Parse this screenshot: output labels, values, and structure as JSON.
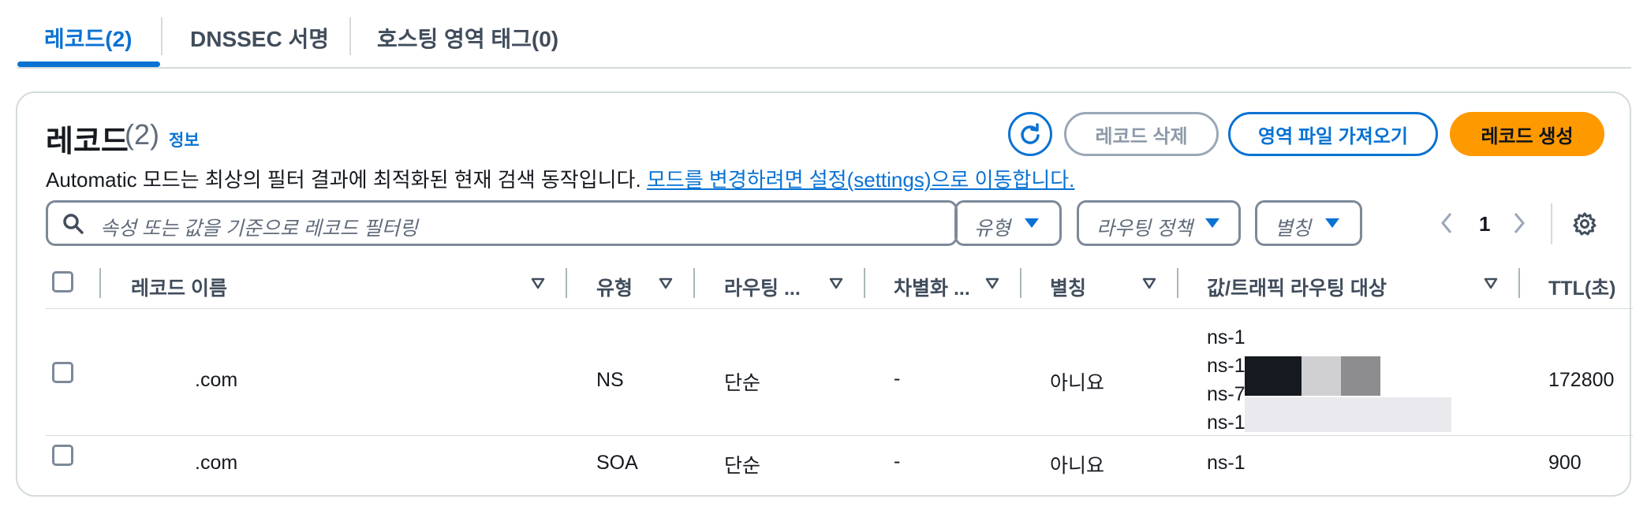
{
  "tabs": [
    {
      "label": "레코드(2)",
      "active": true
    },
    {
      "label": "DNSSEC 서명",
      "active": false
    },
    {
      "label": "호스팅 영역 태그(0)",
      "active": false
    }
  ],
  "panel": {
    "title": "레코드",
    "count": "(2)",
    "info_link": "정보",
    "description": "Automatic 모드는 최상의 필터 결과에 최적화된 현재 검색 동작입니다.",
    "settings_link": "모드를 변경하려면 설정(settings)으로 이동합니다."
  },
  "actions": {
    "delete_label": "레코드 삭제",
    "import_label": "영역 파일 가져오기",
    "create_label": "레코드 생성"
  },
  "filters": {
    "search_placeholder": "속성 또는 값을 기준으로 레코드 필터링",
    "type_label": "유형",
    "routing_label": "라우팅 정책",
    "alias_label": "별칭"
  },
  "pagination": {
    "current_page": "1"
  },
  "table": {
    "columns": {
      "name": "레코드 이름",
      "type": "유형",
      "routing": "라우팅 ...",
      "diff": "차별화 ...",
      "alias": "별칭",
      "value": "값/트래픽 라우팅 대상",
      "ttl": "TTL(초)"
    },
    "rows": [
      {
        "name": ".com",
        "type": "NS",
        "routing": "단순",
        "diff": "-",
        "alias": "아니요",
        "values": [
          "ns-1",
          "ns-1",
          "ns-7",
          "ns-1"
        ],
        "ttl": "172800"
      },
      {
        "name": ".com",
        "type": "SOA",
        "routing": "단순",
        "diff": "-",
        "alias": "아니요",
        "values": [
          "ns-1"
        ],
        "ttl": "900"
      }
    ]
  },
  "colors": {
    "accent": "#0972d3",
    "primary_button": "#ff9900",
    "border": "#7d8998",
    "muted_text": "#5f6b7a"
  },
  "icons": [
    "refresh-icon",
    "search-icon",
    "caret-down-icon",
    "chevron-left-icon",
    "chevron-right-icon",
    "settings-gear-icon",
    "sort-icon"
  ]
}
